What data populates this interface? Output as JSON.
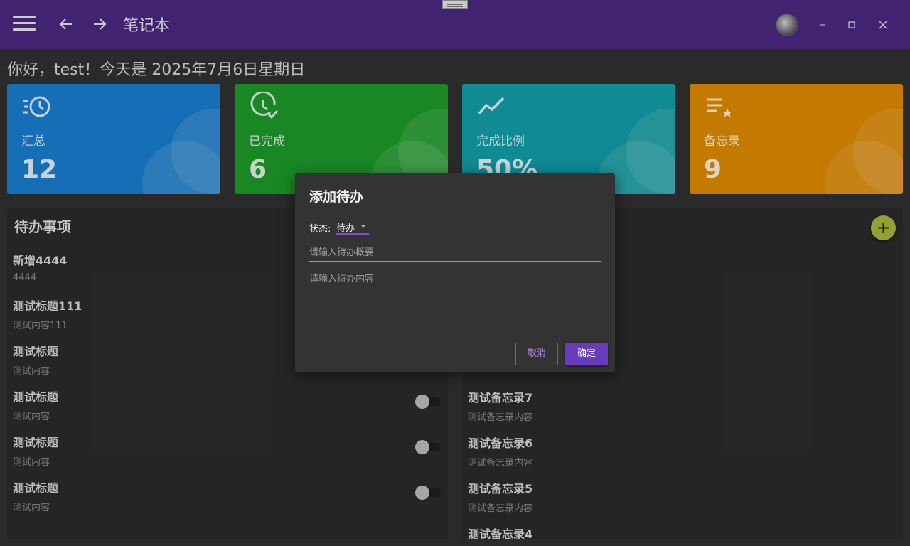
{
  "header": {
    "app_title": "笔记本",
    "colors": {
      "bar": "#4a2882"
    }
  },
  "greeting": "你好，test！今天是 2025年7月6日星期日",
  "stats": [
    {
      "label": "汇总",
      "value": "12",
      "icon": "history-icon",
      "color": "#1a7fd0"
    },
    {
      "label": "已完成",
      "value": "6",
      "icon": "clock-check-icon",
      "color": "#1d9a2a"
    },
    {
      "label": "完成比例",
      "value": "50%",
      "icon": "trend-line-icon",
      "color": "#139ea8"
    },
    {
      "label": "备忘录",
      "value": "9",
      "icon": "list-star-icon",
      "color": "#e08a00"
    }
  ],
  "todo_panel": {
    "title": "待办事项",
    "items": [
      {
        "title": "新增4444",
        "content": "4444"
      },
      {
        "title": "测试标题111",
        "content": "测试内容111"
      },
      {
        "title": "测试标题",
        "content": "测试内容"
      },
      {
        "title": "测试标题",
        "content": "测试内容"
      },
      {
        "title": "测试标题",
        "content": "测试内容"
      },
      {
        "title": "测试标题",
        "content": "测试内容"
      }
    ]
  },
  "memo_panel": {
    "items": [
      {
        "title": "测试备忘录7",
        "content": "测试备忘录内容"
      },
      {
        "title": "测试备忘录6",
        "content": "测试备忘录内容"
      },
      {
        "title": "测试备忘录5",
        "content": "测试备忘录内容"
      },
      {
        "title": "测试备忘录4",
        "content": ""
      }
    ]
  },
  "add_button": {
    "label": "+"
  },
  "dialog": {
    "title": "添加待办",
    "status_label": "状态:",
    "status_value": "待办",
    "summary_placeholder": "请输入待办概要",
    "content_placeholder": "请输入待办内容",
    "cancel_label": "取消",
    "ok_label": "确定"
  }
}
